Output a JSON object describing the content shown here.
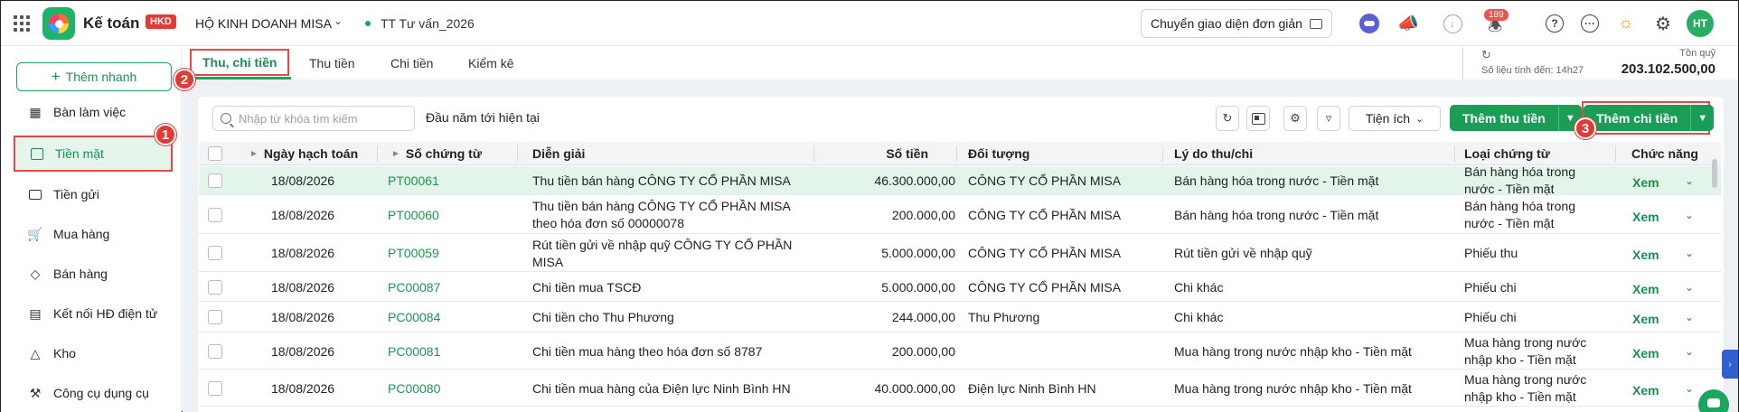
{
  "app": {
    "title": "Kế toán",
    "badge": "HKD",
    "company": "HỘ KINH DOANH MISA",
    "branch": "TT Tư vấn_2026",
    "switch_ui_label": "Chuyển giao diện đơn giản",
    "notification_count": "189",
    "avatar_initials": "HT"
  },
  "sidebar": {
    "quick_add": "Thêm nhanh",
    "items": [
      {
        "label": "Bàn làm việc",
        "icon": "dashboard-icon"
      },
      {
        "label": "Tiền mặt",
        "icon": "wallet-icon"
      },
      {
        "label": "Tiền gửi",
        "icon": "card-icon"
      },
      {
        "label": "Mua hàng",
        "icon": "cart-icon"
      },
      {
        "label": "Bán hàng",
        "icon": "tag-icon"
      },
      {
        "label": "Kết nối HĐ điện tử",
        "icon": "invoice-icon"
      },
      {
        "label": "Kho",
        "icon": "box-icon"
      },
      {
        "label": "Công cụ dụng cụ",
        "icon": "tools-icon"
      }
    ]
  },
  "tabs": [
    "Thu, chi tiền",
    "Thu tiền",
    "Chi tiền",
    "Kiểm kê"
  ],
  "fund": {
    "asof": "Số liệu tính đến: 14h27",
    "label": "Tồn quỹ",
    "amount": "203.102.500,00"
  },
  "toolbar": {
    "search_placeholder": "Nhập từ khóa tìm kiếm",
    "period": "Đầu năm tới hiện tại",
    "utility": "Tiện ích",
    "add_receipt": "Thêm thu tiền",
    "add_payment": "Thêm chi tiền"
  },
  "table": {
    "headers": {
      "date": "Ngày hạch toán",
      "voucher": "Số chứng từ",
      "desc": "Diễn giải",
      "amount": "Số tiền",
      "object": "Đối tượng",
      "reason": "Lý do thu/chi",
      "type": "Loại chứng từ",
      "action": "Chức năng"
    },
    "view_label": "Xem",
    "rows": [
      {
        "date": "18/08/2026",
        "voucher": "PT00061",
        "desc": "Thu tiền bán hàng CÔNG TY CỔ PHẦN MISA",
        "amount": "46.300.000,00",
        "object": "CÔNG TY CỔ PHẦN MISA",
        "reason": "Bán hàng hóa trong nước - Tiền mặt",
        "type": "Bán hàng hóa trong nước - Tiền mặt"
      },
      {
        "date": "18/08/2026",
        "voucher": "PT00060",
        "desc": "Thu tiền bán hàng CÔNG TY CỔ PHẦN MISA theo hóa đơn số 00000078",
        "amount": "200.000,00",
        "object": "CÔNG TY CỔ PHẦN MISA",
        "reason": "Bán hàng hóa trong nước - Tiền mặt",
        "type": "Bán hàng hóa trong nước - Tiền mặt"
      },
      {
        "date": "18/08/2026",
        "voucher": "PT00059",
        "desc": "Rút tiền gửi về nhập quỹ CÔNG TY CỔ PHẦN MISA",
        "amount": "5.000.000,00",
        "object": "CÔNG TY CỔ PHẦN MISA",
        "reason": "Rút tiền gửi về nhập quỹ",
        "type": "Phiếu thu"
      },
      {
        "date": "18/08/2026",
        "voucher": "PC00087",
        "desc": "Chi tiền mua TSCĐ",
        "amount": "5.000.000,00",
        "object": "CÔNG TY CỔ PHẦN MISA",
        "reason": "Chi khác",
        "type": "Phiếu chi"
      },
      {
        "date": "18/08/2026",
        "voucher": "PC00084",
        "desc": "Chi tiền cho Thu Phương",
        "amount": "244.000,00",
        "object": "Thu Phương",
        "reason": "Chi khác",
        "type": "Phiếu chi"
      },
      {
        "date": "18/08/2026",
        "voucher": "PC00081",
        "desc": "Chi tiền mua hàng theo hóa đơn số 8787",
        "amount": "200.000,00",
        "object": "",
        "reason": "Mua hàng trong nước nhập kho - Tiền mặt",
        "type": "Mua hàng trong nước nhập kho - Tiền mặt"
      },
      {
        "date": "18/08/2026",
        "voucher": "PC00080",
        "desc": "Chi tiền mua hàng của Điện lực Ninh Bình HN",
        "amount": "40.000.000,00",
        "object": "Điện lực Ninh Bình HN",
        "reason": "Mua hàng trong nước nhập kho - Tiền mặt",
        "type": "Mua hàng trong nước nhập kho - Tiền mặt"
      }
    ]
  },
  "steps": [
    "1",
    "2",
    "3"
  ],
  "colors": {
    "accent": "#1a9e55",
    "highlight_row": "#e3f5ea",
    "marker": "#e53935"
  }
}
